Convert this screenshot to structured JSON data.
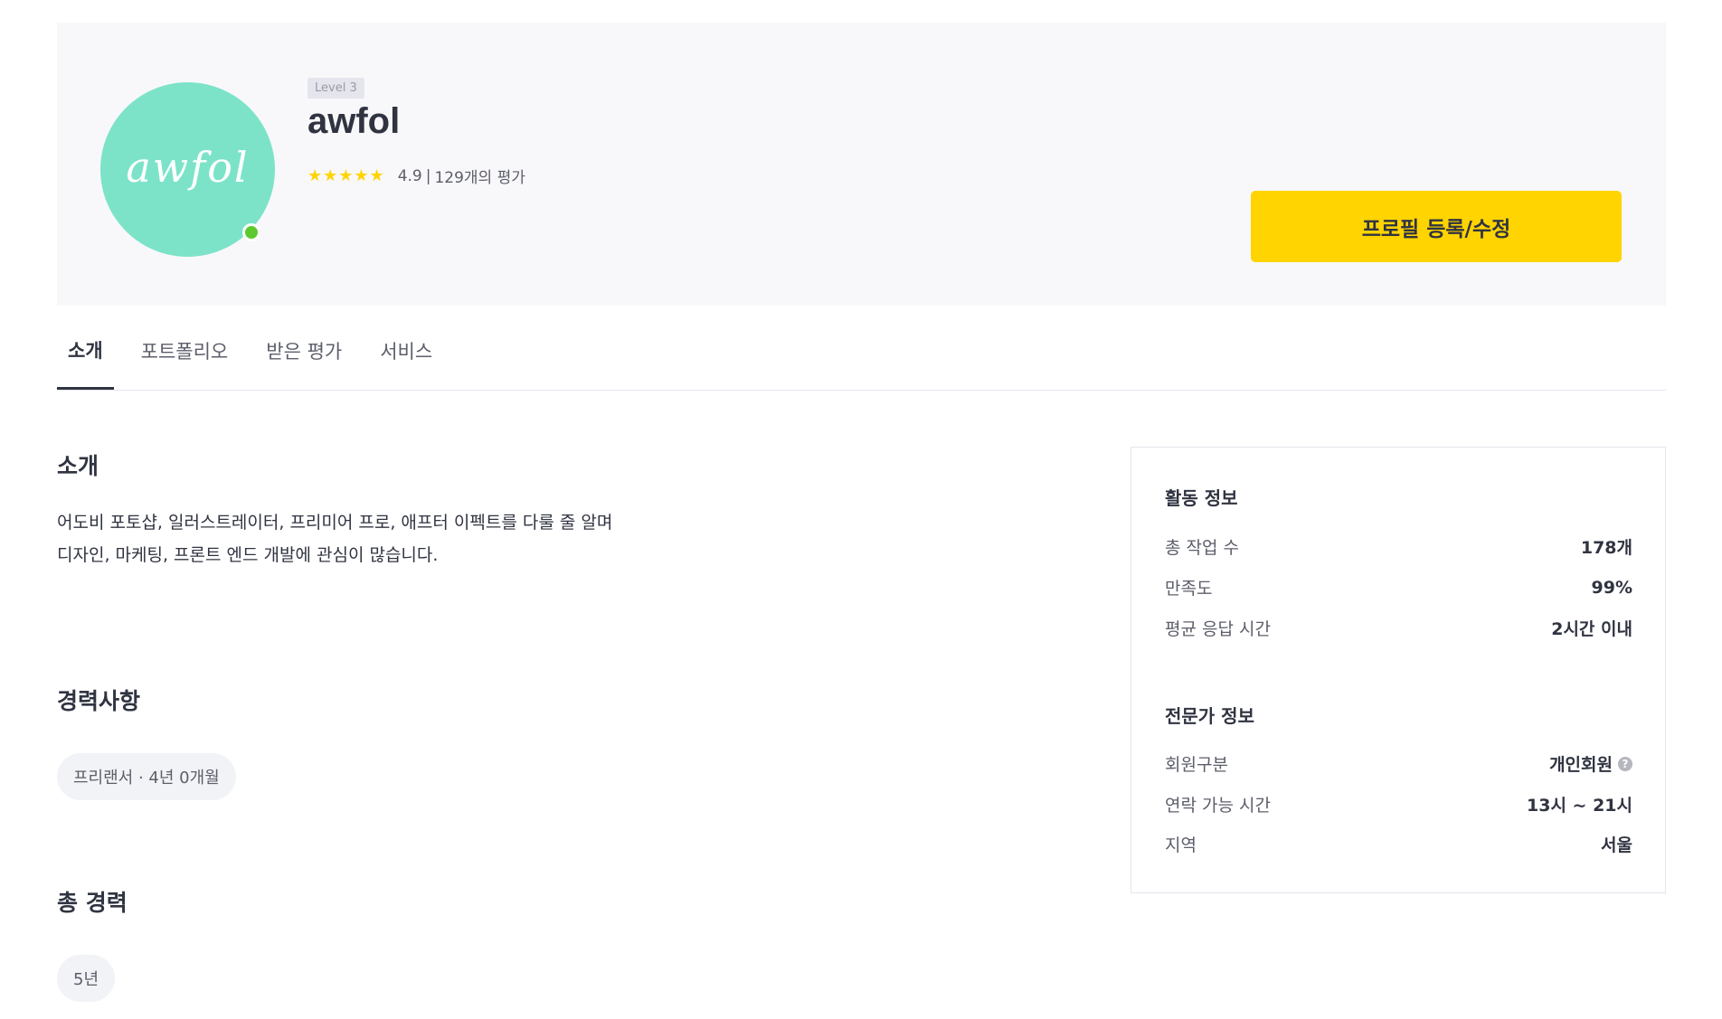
{
  "profile": {
    "avatar_text": "awfol",
    "level": "Level 3",
    "name": "awfol",
    "stars": "★★★★★",
    "rating": "4.9",
    "rating_separator": "|",
    "review_count": "129개의 평가",
    "edit_button_label": "프로필 등록/수정"
  },
  "tabs": [
    {
      "label": "소개",
      "active": true
    },
    {
      "label": "포트폴리오",
      "active": false
    },
    {
      "label": "받은 평가",
      "active": false
    },
    {
      "label": "서비스",
      "active": false
    }
  ],
  "intro": {
    "title": "소개",
    "line1": "어도비 포토샵, 일러스트레이터, 프리미어 프로, 애프터 이펙트를 다룰 줄 알며",
    "line2": "디자인, 마케팅, 프론트 엔드 개발에 관심이 많습니다."
  },
  "career": {
    "title": "경력사항",
    "chip": "프리랜서 · 4년 0개월"
  },
  "total_career": {
    "title": "총 경력",
    "chip": "5년"
  },
  "activity": {
    "heading": "활동 정보",
    "rows": [
      {
        "label": "총 작업 수",
        "value": "178개"
      },
      {
        "label": "만족도",
        "value": "99%"
      },
      {
        "label": "평균 응답 시간",
        "value": "2시간 이내"
      }
    ]
  },
  "expert": {
    "heading": "전문가 정보",
    "rows": [
      {
        "label": "회원구분",
        "value": "개인회원"
      },
      {
        "label": "연락 가능 시간",
        "value": "13시 ~ 21시"
      },
      {
        "label": "지역",
        "value": "서울"
      }
    ]
  },
  "icons": {
    "help": "question-circle-icon",
    "star": "star-icon"
  },
  "colors": {
    "accent": "#ffd400",
    "avatar_bg": "#7ce3c9",
    "online": "#5ec92f"
  }
}
